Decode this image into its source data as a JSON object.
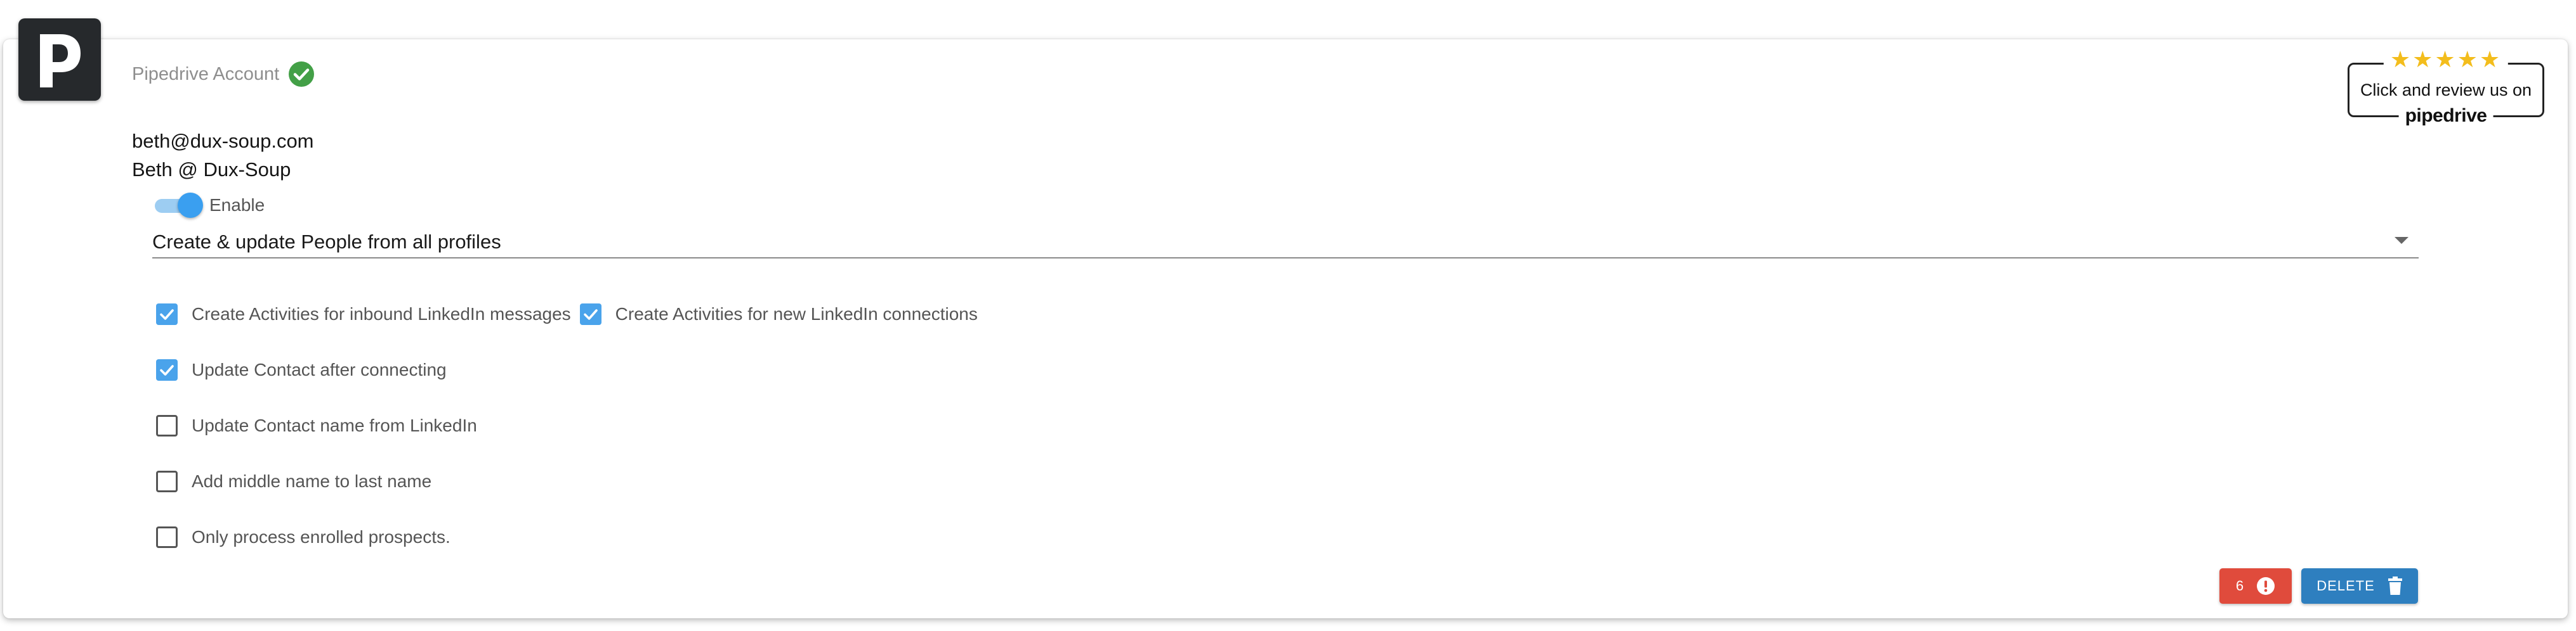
{
  "header": {
    "title": "Pipedrive Account",
    "logo_letter": "p",
    "verified_icon": "check-circle-icon",
    "verified_color": "#43a047"
  },
  "review_badge": {
    "stars": "★★★★★",
    "text": "Click and review us on",
    "brand": "pipedrive",
    "star_color": "#f3bd1c"
  },
  "account": {
    "email": "beth@dux-soup.com",
    "name": "Beth @ Dux-Soup"
  },
  "enable_toggle": {
    "label": "Enable",
    "checked": true,
    "accent": "#3a9ff0"
  },
  "sync_mode": {
    "selected": "Create & update People from all profiles"
  },
  "options": [
    {
      "label": "Create Activities for inbound LinkedIn messages",
      "checked": true
    },
    {
      "label": "Create Activities for new LinkedIn connections",
      "checked": true
    },
    {
      "label": "Update Contact after connecting",
      "checked": true
    },
    {
      "label": "Update Contact name from LinkedIn",
      "checked": false
    },
    {
      "label": "Add middle name to last name",
      "checked": false
    },
    {
      "label": "Only process enrolled prospects.",
      "checked": false
    }
  ],
  "actions": {
    "error_count": "6",
    "error_icon": "alert-circle-icon",
    "error_color": "#e04b3c",
    "delete_label": "DELETE",
    "delete_icon": "trash-icon",
    "delete_color": "#2e7fbf"
  }
}
